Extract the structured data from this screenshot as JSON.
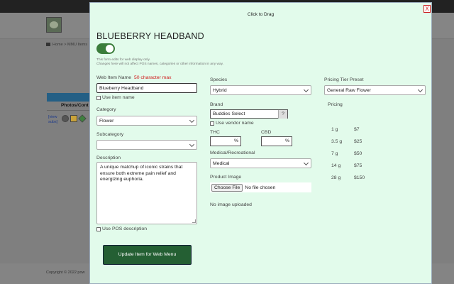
{
  "background": {
    "breadcrumb": [
      "Home",
      "MMU Items"
    ],
    "photos_header": "Photos/Cont",
    "view_link": [
      "[view",
      "subs]"
    ],
    "copyright": "Copyright © 2022 pow"
  },
  "modal": {
    "drag_label": "Click to Drag",
    "close_label": "X",
    "item_title": "BLUEBERRY HEADBAND",
    "toggle_on": true,
    "note_line1": "This form edits for web display only.",
    "note_line2": "Changes here will not affect POS names, categories or other information in any way.",
    "web_item_name": {
      "label": "Web Item Name",
      "limit": "50 character max",
      "value": "Blueberry Headband",
      "use_item_name": "Use item name"
    },
    "category": {
      "label": "Category",
      "value": "Flower"
    },
    "subcategory": {
      "label": "Subcategory",
      "value": ""
    },
    "description": {
      "label": "Description",
      "value": "A unique matchup of iconic strains that ensure both extreme pain relief and energizing euphoria.",
      "use_pos": "Use POS description"
    },
    "species": {
      "label": "Species",
      "value": "Hybrid"
    },
    "brand": {
      "label": "Brand",
      "value": "Buddies Select",
      "help": "?",
      "use_vendor": "Use vendor name"
    },
    "thc": {
      "label": "THC",
      "value": "",
      "unit": "%"
    },
    "cbd": {
      "label": "CBD",
      "value": "",
      "unit": "%"
    },
    "medical": {
      "label": "Medical/Recreational",
      "value": "Medical"
    },
    "product_image": {
      "label": "Product Image",
      "button": "Choose File",
      "status": "No file chosen",
      "uploaded_status": "No image uploaded"
    },
    "pricing_preset": {
      "label": "Pricing Tier Preset",
      "value": "General Raw Flower"
    },
    "pricing": {
      "label": "Pricing",
      "rows": [
        {
          "weight": "1 g",
          "price": "$7"
        },
        {
          "weight": "3.5 g",
          "price": "$25"
        },
        {
          "weight": "7 g",
          "price": "$50"
        },
        {
          "weight": "14 g",
          "price": "$75"
        },
        {
          "weight": "28 g",
          "price": "$150"
        }
      ]
    },
    "submit_label": "Update Item for Web Menu"
  },
  "colors": {
    "modal_bg": "#e2fbeb",
    "submit_bg": "#245f33",
    "toggle_on": "#3b7d3b",
    "required_text": "#d01818"
  }
}
